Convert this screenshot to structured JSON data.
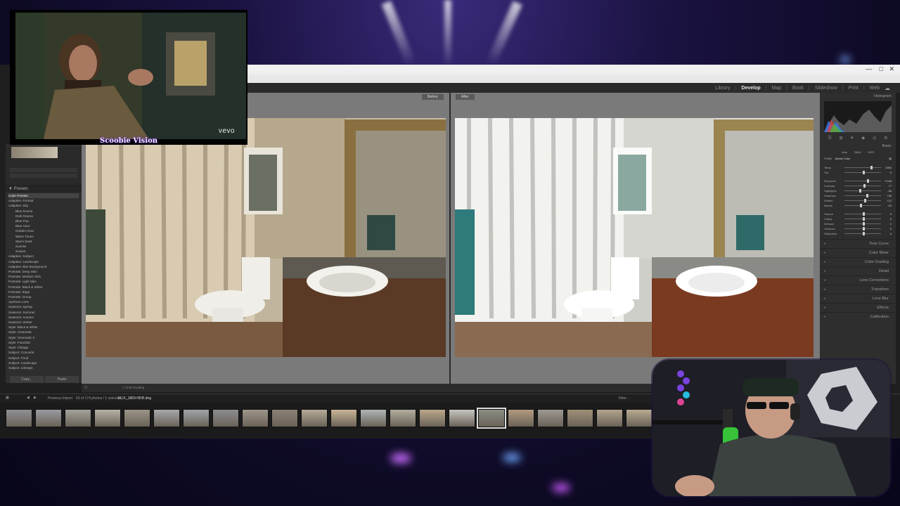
{
  "channel": {
    "overlay_name": "Scoobie Vision",
    "video_brand": "vevo"
  },
  "lightroom": {
    "modules": [
      "Library",
      "Develop",
      "Map",
      "Book",
      "Slideshow",
      "Print",
      "Web"
    ],
    "active_module": "Develop",
    "view_labels": {
      "before": "Before",
      "after": "After"
    },
    "left_panel": {
      "presets_header": "Presets",
      "presets": [
        "Color Presets",
        "Adaptive: Portrait",
        "Adaptive: Sky",
        "Blue Drama",
        "Dark Drama",
        "Blue Pop",
        "Blue Hour",
        "Golden Hour",
        "Warm Tones",
        "Warm Dusk",
        "Sunrise",
        "Sunset",
        "Adaptive: Subject",
        "Adaptive: Landscape",
        "Adaptive: Blur Background",
        "Portraits: Deep Skin",
        "Portraits: Medium Skin",
        "Portraits: Light Skin",
        "Portraits: Black & White",
        "Portraits: Edge",
        "Portraits: Group",
        "Aperture Lens",
        "Seasons: Spring",
        "Seasons: Summer",
        "Seasons: Autumn",
        "Seasons: Winter",
        "Style: Black & White",
        "Style: Cinematic",
        "Style: Cinematic II",
        "Style: Futuristic",
        "Style: Vintage",
        "Subject: Concerts",
        "Subject: Food",
        "Subject: Landscape",
        "Subject: Lifestyle"
      ],
      "copy_button": "Copy...",
      "paste_button": "Paste"
    },
    "right_panel": {
      "histogram_title": "Histogram",
      "basic_title": "Basic",
      "profile_label": "Profile",
      "profile_value": "Adobe Color",
      "treatment_options": [
        "Auto",
        "B&W",
        "HDR"
      ],
      "sliders": [
        {
          "label": "Temp",
          "value": "2950"
        },
        {
          "label": "Tint",
          "value": "0"
        },
        {
          "label": "Exposure",
          "value": "+0.88"
        },
        {
          "label": "Contrast",
          "value": "+7"
        },
        {
          "label": "Highlights",
          "value": "-36"
        },
        {
          "label": "Shadows",
          "value": "+36"
        },
        {
          "label": "Whites",
          "value": "+12"
        },
        {
          "label": "Blacks",
          "value": "-20"
        },
        {
          "label": "Texture",
          "value": "0"
        },
        {
          "label": "Clarity",
          "value": "0"
        },
        {
          "label": "Dehaze",
          "value": "0"
        },
        {
          "label": "Vibrance",
          "value": "0"
        },
        {
          "label": "Saturation",
          "value": "0"
        }
      ],
      "sections": [
        "Tone Curve",
        "Color Mixer",
        "Color Grading",
        "Detail",
        "Lens Corrections",
        "Transform",
        "Lens Blur",
        "Effects",
        "Calibration"
      ]
    },
    "toolbar": {
      "soft_proofing": "Soft Proofing"
    },
    "filmstrip": {
      "prev_import": "Previous Import",
      "count_text": "63 of 174 photos / 1 selected",
      "selected_file": "ELIX_1869-HDR.dng",
      "filter": "Filter :"
    }
  }
}
